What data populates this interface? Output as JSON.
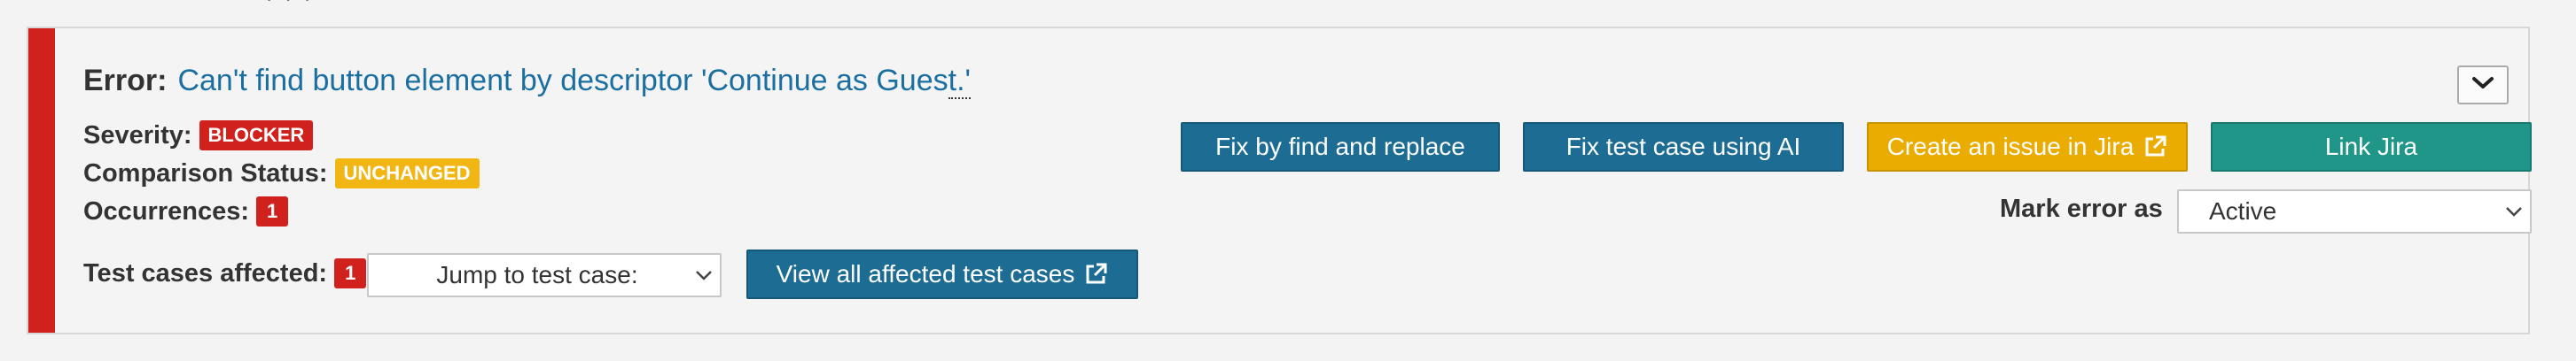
{
  "header_fragment": "· · ·",
  "error": {
    "label": "Error:",
    "message_main": "Can't find button element by descriptor 'Continue as Gues",
    "message_tail": "t.'"
  },
  "severity": {
    "label": "Severity:",
    "value": "BLOCKER"
  },
  "comparison_status": {
    "label": "Comparison Status:",
    "value": "UNCHANGED"
  },
  "occurrences": {
    "label": "Occurrences:",
    "value": "1"
  },
  "test_cases_affected": {
    "label": "Test cases affected:",
    "count": "1",
    "jump_select": "Jump to test case:",
    "view_all_button": "View all affected test cases"
  },
  "actions": {
    "fix_replace": "Fix by find and replace",
    "fix_ai": "Fix test case using AI",
    "create_jira": "Create an issue in Jira",
    "link_jira": "Link Jira"
  },
  "mark_error": {
    "label": "Mark error as",
    "value": "Active"
  },
  "icons": {
    "collapse": "chevron-down-icon",
    "external": "external-link-icon"
  },
  "colors": {
    "error_stripe": "#d0211c",
    "blocker_badge": "#d0211c",
    "unchanged_badge": "#f1b514",
    "primary_button": "#1d6c93",
    "jira_button": "#eaac00",
    "link_jira_button": "#1f9688",
    "error_message": "#1a6fa0"
  }
}
